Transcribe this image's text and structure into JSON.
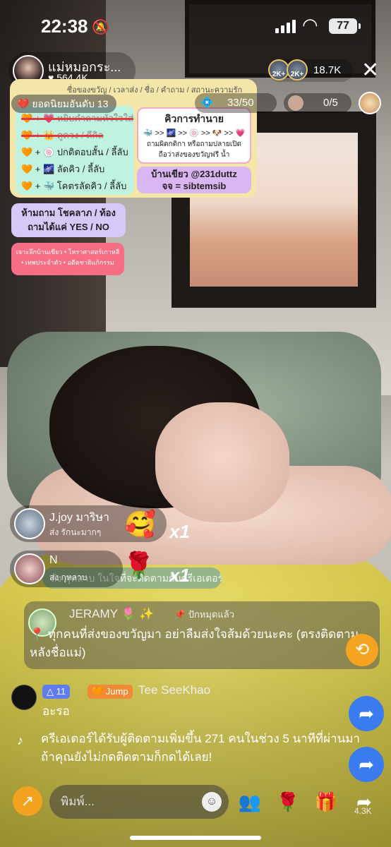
{
  "status_bar": {
    "time": "22:38",
    "battery": "77"
  },
  "host": {
    "name": "แม่หมอกระ...",
    "likes": "♥ 564.4K"
  },
  "viewers": {
    "badge1": "2K+",
    "badge2": "2K+",
    "count": "18.7K"
  },
  "rank": "💔 ยอดนิยมอันดับ 13",
  "goal": {
    "current": "33/50"
  },
  "match": {
    "value": "0/5"
  },
  "board": {
    "header": "ชื่อของขวัญ / เวลาส่ง / ชื่อ / คำถาม / สถานะความรัก",
    "rows": [
      "🧡 + 💗 หยิบคำถามหัวใจใส่",
      "🧡 + 👑 ดูดวง / ดีกิล",
      "🧡 + 🍥 ปกติตอบสั้น / ลี้ลับ",
      "🧡 + 🌌 ลัดคิว / ลี้ลับ",
      "🧡 + 🐳 โคตรลัดคิว / ลี้ลับ"
    ],
    "queue_title": "คิวการทำนาย",
    "queue_flow": "🐳 >> 🌌 >> 🍥 >> 🐶 >> 💗",
    "queue_note1": "ถามผิดกติกา หรือถามปลายเปิด",
    "queue_note2": "ถือว่าส่งของขวัญฟรี น้ำ",
    "home_line1": "บ้านเขียว @231duttz",
    "home_line2": "จจ = sibtemsib"
  },
  "rules1": {
    "line1": "ห้ามถาม โชคลาภ / ท้อง",
    "line2": "ถามได้แค่ YES / NO"
  },
  "rules2": {
    "line1": "เจาะลึกบ้านเขียว • โหราศาสตร์เกาหลี",
    "line2": "• เทพประจำตัว • อดีตชาติแก้กรรม"
  },
  "gifts": [
    {
      "name": "J.joy มาริษา",
      "text": "ส่ง รักนะมากๆ",
      "emoji": "🥰",
      "count": "x1"
    },
    {
      "name": "N",
      "text": "ส่ง กุหลาบ",
      "emoji": "🌹",
      "count": "x1"
    }
  ],
  "follow_strip": "ส่ง กุหลาบ ในใจที่จะติดตามกับครีเอเตอร์",
  "pinned": {
    "user": "JERAMY 🌷 ✨",
    "pin_label": "📌 ปักหมุดแล้ว",
    "text": "📍 ทุกคนที่ส่งของขวัญมา อย่าลืมส่งใจส้มด้วยนะคะ (ตรงติดตามหลังชื่อแม่)"
  },
  "comment": {
    "level": "△ 11",
    "badge": "🧡 Jump",
    "user": "Tee SeeKhao",
    "text": "อะรอ"
  },
  "system_msg": "ครีเอเตอร์ได้รับผู้ติดตามเพิ่มขึ้น 271 คนในช่วง 5 นาทีที่ผ่านมา ถ้าคุณยังไม่กดติดตามก็กดได้เลย!",
  "bottom": {
    "placeholder": "พิมพ์...",
    "share_count": "4.3K"
  }
}
